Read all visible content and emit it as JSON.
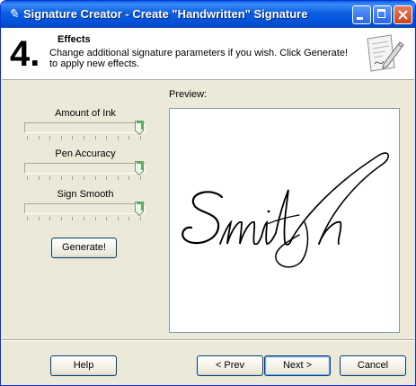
{
  "window": {
    "title": "Signature Creator - Create \"Handwritten\" Signature",
    "title_icon": "pen-nib-icon"
  },
  "header": {
    "step_number": "4.",
    "step_title": "Effects",
    "description": "Change additional signature parameters if you wish. Click Generate! to apply new effects.",
    "icon": "signed-document-icon"
  },
  "params": [
    {
      "label": "Amount of Ink",
      "value_fraction": 1.0
    },
    {
      "label": "Pen Accuracy",
      "value_fraction": 1.0
    },
    {
      "label": "Sign Smooth",
      "value_fraction": 1.0
    }
  ],
  "generate_label": "Generate!",
  "preview": {
    "label": "Preview:",
    "signature_text": "Smith"
  },
  "footer": {
    "help_label": "Help",
    "prev_label": "< Prev",
    "next_label": "Next >",
    "cancel_label": "Cancel"
  },
  "colors": {
    "title_bar": "#0151d8",
    "window_bg": "#ece9d8",
    "slider_thumb": "#21a121"
  }
}
